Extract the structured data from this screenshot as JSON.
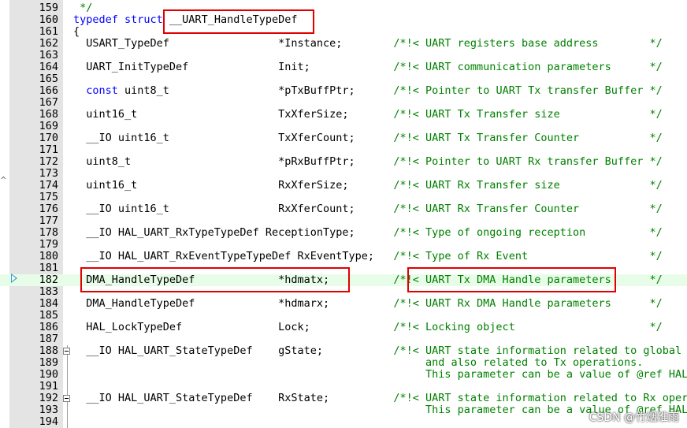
{
  "lines": [
    {
      "n": "159",
      "t": " */",
      "s": "c"
    },
    {
      "n": "160",
      "t": "typedef struct __UART_HandleTypeDef",
      "s": "td"
    },
    {
      "n": "161",
      "t": "{",
      "s": "p"
    },
    {
      "n": "162",
      "t": "  USART_TypeDef                 *Instance;        /*!< UART registers base address        */",
      "s": "x"
    },
    {
      "n": "163",
      "t": "",
      "s": "p"
    },
    {
      "n": "164",
      "t": "  UART_InitTypeDef              Init;             /*!< UART communication parameters      */",
      "s": "x"
    },
    {
      "n": "165",
      "t": "",
      "s": "p"
    },
    {
      "n": "166",
      "t": "  const uint8_t                 *pTxBuffPtr;      /*!< Pointer to UART Tx transfer Buffer */",
      "s": "k"
    },
    {
      "n": "167",
      "t": "",
      "s": "p"
    },
    {
      "n": "168",
      "t": "  uint16_t                      TxXferSize;       /*!< UART Tx Transfer size              */",
      "s": "x"
    },
    {
      "n": "169",
      "t": "",
      "s": "p"
    },
    {
      "n": "170",
      "t": "  __IO uint16_t                 TxXferCount;      /*!< UART Tx Transfer Counter           */",
      "s": "x"
    },
    {
      "n": "171",
      "t": "",
      "s": "p"
    },
    {
      "n": "172",
      "t": "  uint8_t                       *pRxBuffPtr;      /*!< Pointer to UART Rx transfer Buffer */",
      "s": "x"
    },
    {
      "n": "173",
      "t": "",
      "s": "p"
    },
    {
      "n": "174",
      "t": "  uint16_t                      RxXferSize;       /*!< UART Rx Transfer size              */",
      "s": "x"
    },
    {
      "n": "175",
      "t": "",
      "s": "p"
    },
    {
      "n": "176",
      "t": "  __IO uint16_t                 RxXferCount;      /*!< UART Rx Transfer Counter           */",
      "s": "x"
    },
    {
      "n": "177",
      "t": "",
      "s": "p"
    },
    {
      "n": "178",
      "t": "  __IO HAL_UART_RxTypeTypeDef ReceptionType;      /*!< Type of ongoing reception          */",
      "s": "x"
    },
    {
      "n": "179",
      "t": "",
      "s": "p"
    },
    {
      "n": "180",
      "t": "  __IO HAL_UART_RxEventTypeTypeDef RxEventType;   /*!< Type of Rx Event                   */",
      "s": "x"
    },
    {
      "n": "181",
      "t": "",
      "s": "p"
    },
    {
      "n": "182",
      "t": "  DMA_HandleTypeDef             *hdmatx;          /*!< UART Tx DMA Handle parameters      */",
      "s": "x"
    },
    {
      "n": "183",
      "t": "",
      "s": "p"
    },
    {
      "n": "184",
      "t": "  DMA_HandleTypeDef             *hdmarx;          /*!< UART Rx DMA Handle parameters      */",
      "s": "x"
    },
    {
      "n": "185",
      "t": "",
      "s": "p"
    },
    {
      "n": "186",
      "t": "  HAL_LockTypeDef               Lock;             /*!< Locking object                     */",
      "s": "x"
    },
    {
      "n": "187",
      "t": "",
      "s": "p"
    },
    {
      "n": "188",
      "t": "  __IO HAL_UART_StateTypeDef    gState;           /*!< UART state information related to global Ha",
      "s": "x"
    },
    {
      "n": "189",
      "t": "                                                       and also related to Tx operations.",
      "s": "c"
    },
    {
      "n": "190",
      "t": "                                                       This parameter can be a value of @ref HAL_U",
      "s": "c"
    },
    {
      "n": "191",
      "t": "",
      "s": "p"
    },
    {
      "n": "192",
      "t": "  __IO HAL_UART_StateTypeDef    RxState;          /*!< UART state information related to Rx operat",
      "s": "x"
    },
    {
      "n": "193",
      "t": "                                                       This parameter can be a value of @ref HAL_U",
      "s": "c"
    },
    {
      "n": "194",
      "t": "",
      "s": "p"
    }
  ],
  "watermark": "CSDN @竹烟淮雨",
  "edge_mark": "^",
  "colors": {
    "keyword": "#0000ff",
    "comment": "#008000",
    "highlight": "#e8fde8",
    "annotation": "#e00000"
  }
}
